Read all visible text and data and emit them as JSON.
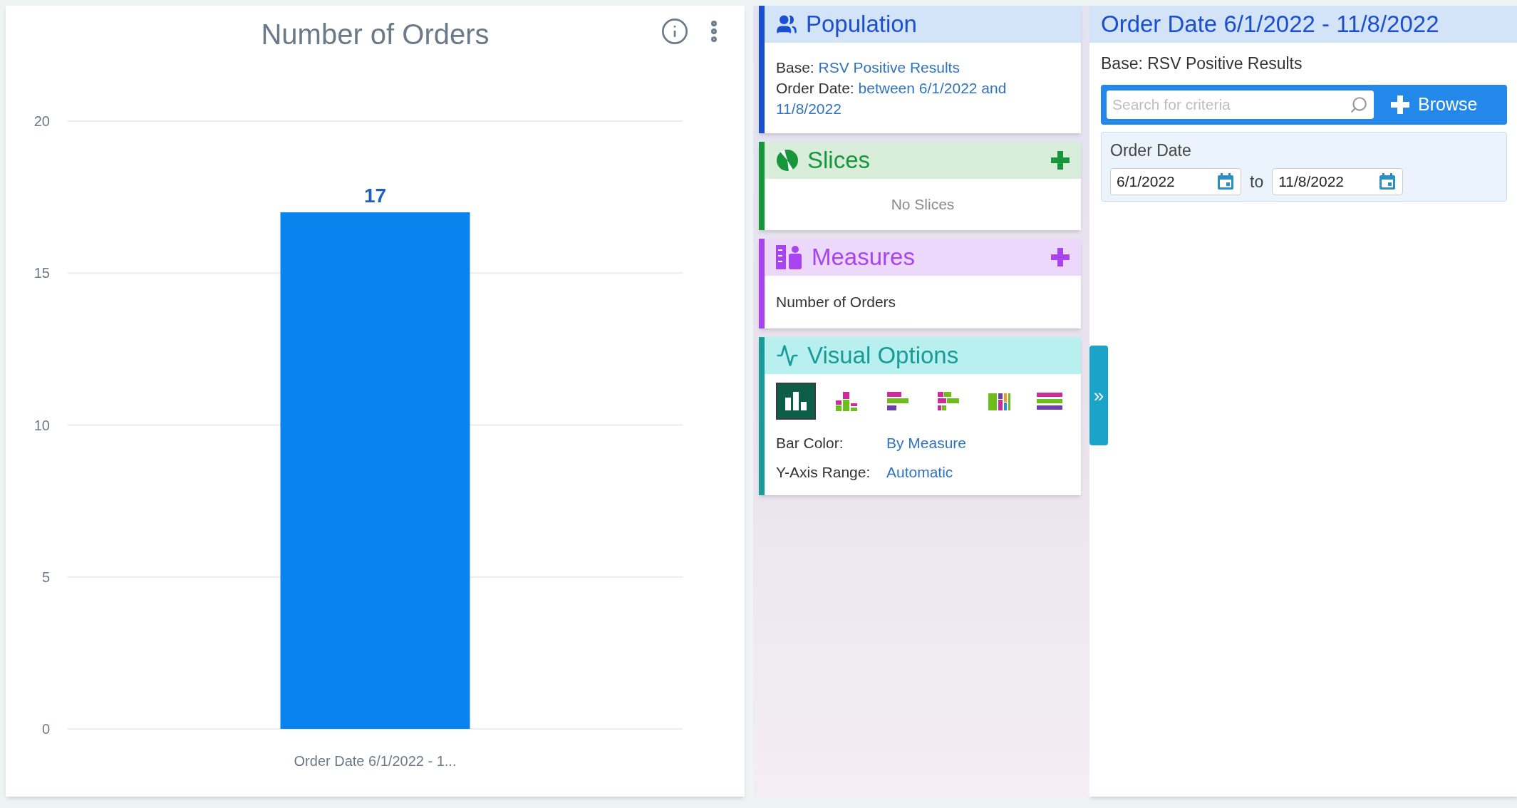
{
  "chart_card": {
    "title": "Number of Orders",
    "chart_data": {
      "type": "bar",
      "categories": [
        "Order Date 6/1/2022 - 1..."
      ],
      "values": [
        17
      ],
      "ylim": [
        0,
        20
      ],
      "yticks": [
        0,
        5,
        10,
        15,
        20
      ],
      "data_labels": true,
      "grid": true,
      "color": "#0984ef"
    }
  },
  "population": {
    "title": "Population",
    "lines": [
      {
        "label": "Base:",
        "value": "RSV Positive Results"
      },
      {
        "label": "Order Date:",
        "value": "between 6/1/2022 and 11/8/2022"
      }
    ]
  },
  "slices": {
    "title": "Slices",
    "empty_text": "No Slices"
  },
  "measures": {
    "title": "Measures",
    "items": [
      "Number of Orders"
    ]
  },
  "visual_options": {
    "title": "Visual Options",
    "chart_types": [
      {
        "kind": "column",
        "selected": true
      },
      {
        "kind": "stacked-column",
        "selected": false
      },
      {
        "kind": "bar",
        "selected": false
      },
      {
        "kind": "stacked-bar",
        "selected": false
      },
      {
        "kind": "percent-column",
        "selected": false
      },
      {
        "kind": "list",
        "selected": false
      }
    ],
    "settings": [
      {
        "label": "Bar Color:",
        "value": "By Measure"
      },
      {
        "label": "Y-Axis Range:",
        "value": "Automatic"
      }
    ],
    "expand_label": "»"
  },
  "criteria": {
    "title": "Order Date 6/1/2022 - 11/8/2022",
    "base": "Base: RSV Positive Results",
    "search": {
      "placeholder": "Search for criteria"
    },
    "browse_label": "Browse",
    "filter": {
      "label": "Order Date",
      "from": "6/1/2022",
      "joiner": "to",
      "to": "11/8/2022"
    }
  }
}
